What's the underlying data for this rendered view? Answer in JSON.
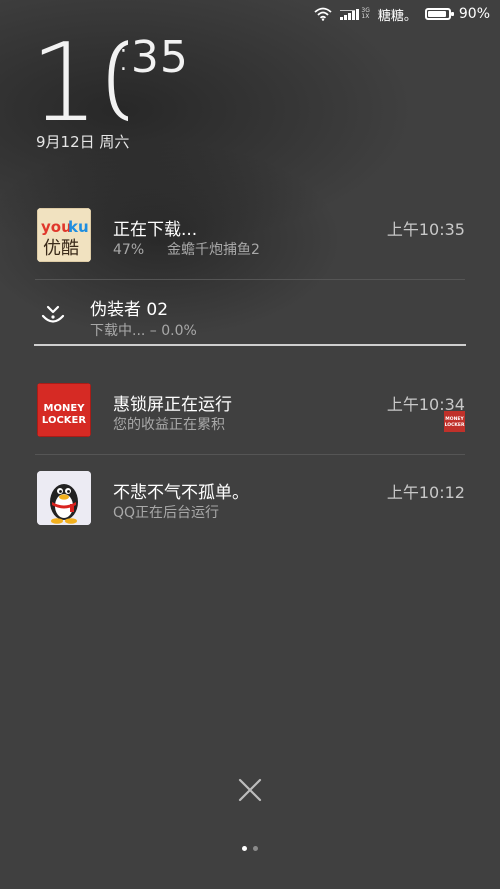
{
  "status_bar": {
    "wifi_icon": "wifi-icon",
    "signal_icon": "signal-icon",
    "network_top": "3G",
    "network_bottom": "1X",
    "carrier": "糖糖。",
    "battery_level": 0.9,
    "battery_label": "90%"
  },
  "lockscreen": {
    "clock_hours": "10",
    "clock_separator": ":",
    "clock_minutes": "35",
    "date": "9月12日 周六"
  },
  "notifications": [
    {
      "app": "youku",
      "icon": "youku-app-icon",
      "icon_text_top": "you",
      "icon_text_top2": "ku",
      "icon_text_bottom": "优酷",
      "title": "正在下载...",
      "subtitle_left": "47%",
      "subtitle_right": "金蟾千炮捕鱼2",
      "time": "上午10:35"
    },
    {
      "app": "downloader",
      "icon": "download-icon",
      "title": "伪装者 02",
      "subtitle": "下载中... – 0.0%",
      "progress": 0.0
    },
    {
      "app": "money-locker",
      "icon": "money-locker-app-icon",
      "icon_text_top": "MONEY",
      "icon_text_bottom": "LOCKER",
      "title": "惠锁屏正在运行",
      "subtitle": "您的收益正在累积",
      "time": "上午10:34",
      "small_icon_top": "MONEY",
      "small_icon_bottom": "LOCKER"
    },
    {
      "app": "qq",
      "icon": "qq-penguin-icon",
      "title": "不悲不气不孤单。",
      "subtitle": "QQ正在后台运行",
      "time": "上午10:12"
    }
  ],
  "controls": {
    "clear_icon": "close-icon",
    "page_indicator_count": 2,
    "page_indicator_active": 0
  },
  "colors": {
    "background": "#404040",
    "money_locker_red": "#d62a24",
    "qq_blue": "#3b7dd8",
    "youku_red": "#e0372b",
    "youku_blue": "#1f8ee0"
  }
}
